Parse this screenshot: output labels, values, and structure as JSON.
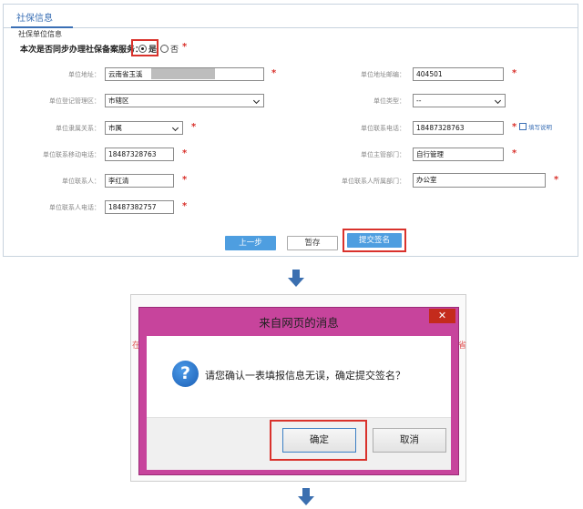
{
  "form": {
    "tab_label": "社保信息",
    "section_title": "社保单位信息",
    "sync_question": "本次是否同步办理社保备案服务：",
    "radio_yes": "是",
    "radio_no": "否",
    "required_mark": "*",
    "fields": {
      "unit_address": {
        "label": "单位地址：",
        "value": "云南省玉溪"
      },
      "postal_code": {
        "label": "单位地址邮编：",
        "value": "404501"
      },
      "district": {
        "label": "单位登记管理区：",
        "value": "市辖区"
      },
      "unit_type": {
        "label": "单位类型：",
        "value": "--"
      },
      "affiliation": {
        "label": "单位隶属关系：",
        "value": "市属"
      },
      "unit_phone": {
        "label": "单位联系电话：",
        "value": "18487328763"
      },
      "unit_mobile": {
        "label": "单位联系移动电话：",
        "value": "18487328763"
      },
      "supervisor_dept": {
        "label": "单位主管部门：",
        "value": "自行管理"
      },
      "contact_person": {
        "label": "单位联系人：",
        "value": "李红清"
      },
      "contact_dept": {
        "label": "单位联系人所属部门：",
        "value": "办公室"
      },
      "contact_phone": {
        "label": "单位联系人电话：",
        "value": "18487382757"
      }
    },
    "help_link": "填写说明",
    "buttons": {
      "prev": "上一步",
      "save": "暂存",
      "submit": "提交签名"
    }
  },
  "dialog": {
    "title": "来自网页的消息",
    "close_glyph": "✕",
    "icon_glyph": "?",
    "message": "请您确认一表填报信息无误，确定提交签名？",
    "ok": "确定",
    "cancel": "取消",
    "side_fragment_left": "在",
    "side_fragment_right": "省"
  },
  "colors": {
    "accent": "#4e9ee0",
    "highlight": "#d9322c",
    "dialog_frame": "#c7449c",
    "arrow": "#3b6fb0"
  }
}
